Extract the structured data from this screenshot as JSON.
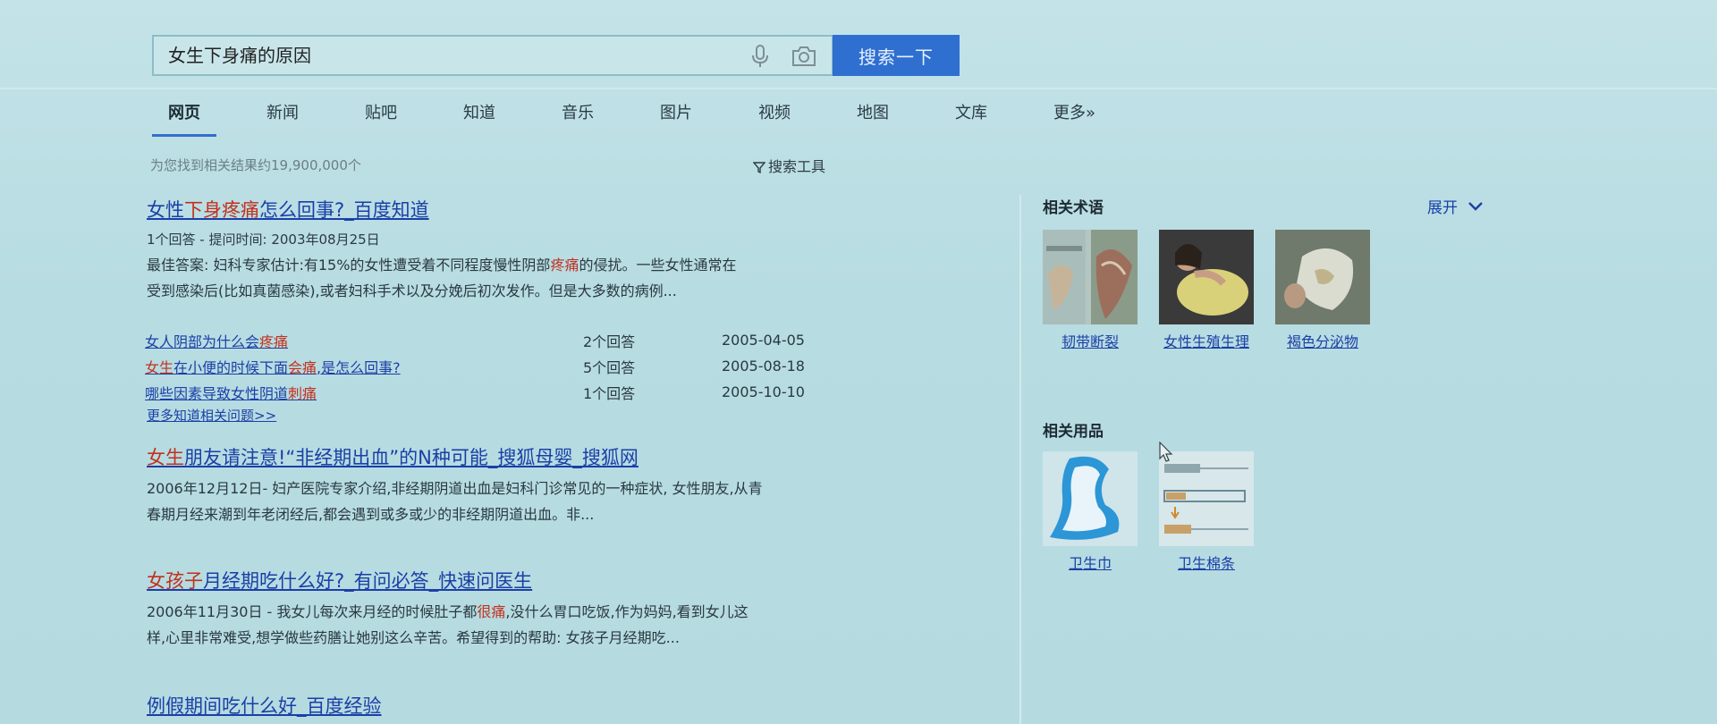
{
  "search": {
    "query": "女生下身痛的原因",
    "button_label": "搜索一下"
  },
  "tabs": [
    {
      "label": "网页",
      "active": true
    },
    {
      "label": "新闻"
    },
    {
      "label": "贴吧"
    },
    {
      "label": "知道"
    },
    {
      "label": "音乐"
    },
    {
      "label": "图片"
    },
    {
      "label": "视频"
    },
    {
      "label": "地图"
    },
    {
      "label": "文库"
    },
    {
      "label": "更多»"
    }
  ],
  "result_count": "为您找到相关结果约19,900,000个",
  "search_tools": "搜索工具",
  "results": [
    {
      "title_parts": [
        "女性",
        "下身疼痛",
        "怎么回事?_百度知道"
      ],
      "meta": "1个回答 - 提问时间: 2003年08月25日",
      "snippet_1a": "最佳答案: 妇科专家估计:有15%的女性遭受着不同程度慢性阴部",
      "snippet_1em": "疼痛",
      "snippet_1b": "的侵扰。一些女性通常在",
      "snippet_2": "受到感染后(比如真菌感染),或者妇科手术以及分娩后初次发作。但是大多数的病例..."
    },
    {
      "title_em": "女生",
      "title_rest": "朋友请注意!“非经期出血”的N种可能_搜狐母婴_搜狐网",
      "snippet_1": "2006年12月12日- 妇产医院专家介绍,非经期阴道出血是妇科门诊常见的一种症状, 女性朋友,从青",
      "snippet_2": "春期月经来潮到年老闭经后,都会遇到或多或少的非经期阴道出血。非..."
    },
    {
      "title_em": "女孩子",
      "title_rest": "月经期吃什么好?_有问必答_快速问医生",
      "snippet_1a": "2006年11月30日 - 我女儿每次来月经的时候肚子都",
      "snippet_1em": "很痛",
      "snippet_1b": ",没什么胃口吃饭,作为妈妈,看到女儿这",
      "snippet_2": "样,心里非常难受,想学做些药膳让她别这么辛苦。希望得到的帮助: 女孩子月经期吃..."
    },
    {
      "title": "例假期间吃什么好_百度经验"
    }
  ],
  "sub_questions": [
    {
      "q_a": "女人阴部为什么会",
      "q_em": "疼痛",
      "q_b": "",
      "q_pre_em": "",
      "answers": "2个回答",
      "date": "2005-04-05"
    },
    {
      "q_pre_em": "女生",
      "q_a": "在小便的时候下面",
      "q_em": "会痛",
      "q_b": ",是怎么回事?",
      "answers": "5个回答",
      "date": "2005-08-18"
    },
    {
      "q_a": "哪些因素导致女性阴道",
      "q_em": "刺痛",
      "q_b": "",
      "q_pre_em": "",
      "answers": "1个回答",
      "date": "2005-10-10"
    }
  ],
  "more_link": "更多知道相关问题>>",
  "side": {
    "terms_title": "相关术语",
    "expand_label": "展开",
    "terms": [
      "韧带断裂",
      "女性生殖生理",
      "褐色分泌物"
    ],
    "products_title": "相关用品",
    "products": [
      "卫生巾",
      "卫生棉条"
    ]
  },
  "colors": {
    "link": "#1b3fa6",
    "highlight": "#c2301e",
    "button": "#2f6fd0"
  }
}
